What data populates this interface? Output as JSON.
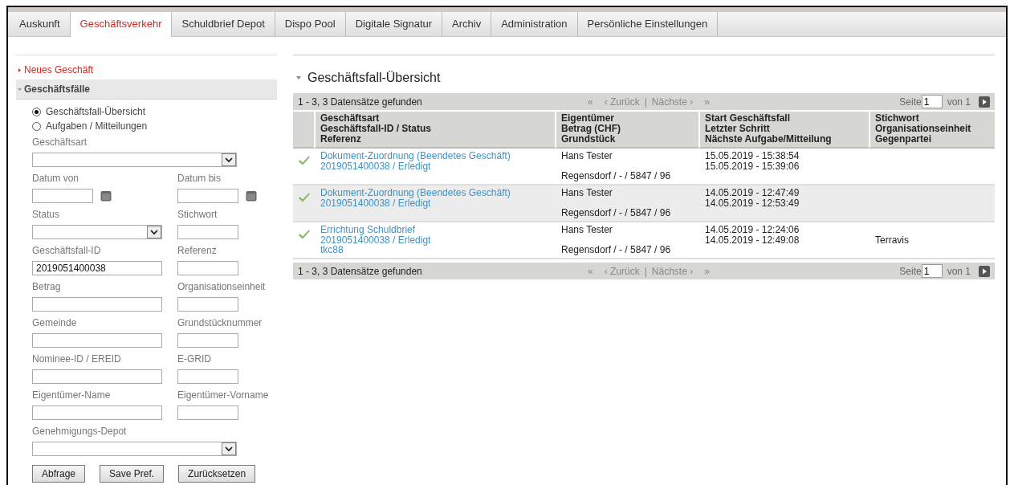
{
  "tabs": [
    {
      "label": "Auskunft",
      "selected": false
    },
    {
      "label": "Geschäftsverkehr",
      "selected": true
    },
    {
      "label": "Schuldbrief Depot",
      "selected": false
    },
    {
      "label": "Dispo Pool",
      "selected": false
    },
    {
      "label": "Digitale Signatur",
      "selected": false
    },
    {
      "label": "Archiv",
      "selected": false
    },
    {
      "label": "Administration",
      "selected": false
    },
    {
      "label": "Persönliche Einstellungen",
      "selected": false
    }
  ],
  "sidebar": {
    "sections": [
      {
        "label": "Neues Geschäft",
        "expanded": false
      },
      {
        "label": "Geschäftsfälle",
        "expanded": true
      }
    ],
    "radios": [
      {
        "label": "Geschäftsfall-Übersicht",
        "selected": true
      },
      {
        "label": "Aufgaben / Mitteilungen",
        "selected": false
      }
    ],
    "fields": [
      {
        "label": "Geschäftsart",
        "kind": "wide-select"
      },
      {
        "label": "Datum von",
        "kind": "date"
      },
      {
        "label": "Datum bis",
        "kind": "date"
      },
      {
        "label": "Status",
        "kind": "select"
      },
      {
        "label": "Stichwort",
        "kind": "short"
      },
      {
        "label": "Geschäftsfall-ID",
        "kind": "text",
        "value": "2019051400038"
      },
      {
        "label": "Referenz",
        "kind": "short"
      },
      {
        "label": "Betrag",
        "kind": "text"
      },
      {
        "label": "Organisationseinheit",
        "kind": "short"
      },
      {
        "label": "Gemeinde",
        "kind": "text"
      },
      {
        "label": "Grundstücknummer",
        "kind": "short"
      },
      {
        "label": "Nominee-ID / EREID",
        "kind": "text"
      },
      {
        "label": "E-GRID",
        "kind": "short"
      },
      {
        "label": "Eigentümer-Name",
        "kind": "text"
      },
      {
        "label": "Eigentümer-Vorname",
        "kind": "short"
      },
      {
        "label": "Genehmigungs-Depot",
        "kind": "wide-select"
      }
    ],
    "buttons": [
      "Abfrage",
      "Save Pref.",
      "Zurücksetzen"
    ]
  },
  "main": {
    "title": "Geschäftsfall-Übersicht",
    "pagers": [
      {
        "count": "1 - 3, 3 Datensätze gefunden",
        "first": "«",
        "prev": "‹ Zurück",
        "separator": "|",
        "next": "Nächste ›",
        "last": "»",
        "page_label": "Seite",
        "page_value": "1",
        "page_of": "von 1"
      },
      {
        "count": "1 - 3, 3 Datensätze gefunden",
        "first": "«",
        "prev": "‹ Zurück",
        "separator": "|",
        "next": "Nächste ›",
        "last": "»",
        "page_label": "Seite",
        "page_value": "1",
        "page_of": "von 1"
      }
    ],
    "table": {
      "columns": [
        [
          "Geschäftsart",
          "Geschäftsfall-ID / Status",
          "Referenz"
        ],
        [
          "Eigentümer",
          "Betrag (CHF)",
          "Grundstück"
        ],
        [
          "Start Geschäftsfall",
          "Letzter Schritt",
          "Nächste Aufgabe/Mitteilung"
        ],
        [
          "Stichwort",
          "Organisationseinheit",
          "Gegenpartei"
        ]
      ],
      "rows": [
        {
          "done": true,
          "business": [
            "Dokument-Zuordnung (Beendetes Geschäft)",
            "2019051400038 / Erledigt"
          ],
          "owner": "Hans Tester",
          "parcel": "Regensdorf / - / 5847 / 96",
          "dates": [
            "15.05.2019 - 15:38:54",
            "15.05.2019 - 15:39:06"
          ]
        },
        {
          "done": true,
          "business": [
            "Dokument-Zuordnung (Beendetes Geschäft)",
            "2019051400038 / Erledigt"
          ],
          "owner": "Hans Tester",
          "parcel": "Regensdorf / - / 5847 / 96",
          "dates": [
            "14.05.2019 - 12:47:49",
            "14.05.2019 - 12:53:49"
          ]
        },
        {
          "done": true,
          "business": [
            "Errichtung Schuldbrief",
            "2019051400038 / Erledigt",
            "tkc88"
          ],
          "owner": "Hans Tester",
          "parcel": "Regensdorf / - / 5847 / 96",
          "dates": [
            "14.05.2019 - 12:24:06",
            "14.05.2019 - 12:49:08"
          ],
          "org_unit": "Terravis"
        }
      ]
    }
  }
}
